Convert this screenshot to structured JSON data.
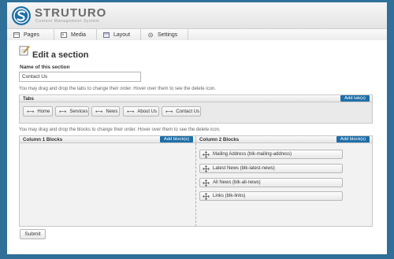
{
  "brand": {
    "name": "STRUTURO",
    "tagline": "Content Management System",
    "accent": "#1e6fa8"
  },
  "nav": {
    "items": [
      {
        "label": "Pages",
        "icon": "pages-icon"
      },
      {
        "label": "Media",
        "icon": "media-icon"
      },
      {
        "label": "Layout",
        "icon": "layout-icon"
      },
      {
        "label": "Settings",
        "icon": "gear-icon"
      }
    ]
  },
  "page": {
    "title": "Edit a section",
    "name_label": "Name of this section",
    "name_value": "Contact Us",
    "tabs_help": "You may drag and drop the tabs to change their order. Hover over them to see the delete icon.",
    "blocks_help": "You may drag and drop the blocks to change their order. Hover over them to see the delete icon.",
    "submit_label": "Submit"
  },
  "tabs": {
    "header": "Tabs",
    "add_label": "Add tab(s)",
    "items": [
      "Home",
      "Services",
      "News",
      "About Us",
      "Contact Us"
    ]
  },
  "columns": {
    "col1": {
      "header": "Column 1 Blocks",
      "add_label": "Add block(s)"
    },
    "col2": {
      "header": "Column 2 Blocks",
      "add_label": "Add block(s)",
      "blocks": [
        "Mailing Address (blk-mailing-address)",
        "Latest News (blk-latest-news)",
        "All News (blk-all-news)",
        "Links (blk-links)"
      ]
    }
  }
}
